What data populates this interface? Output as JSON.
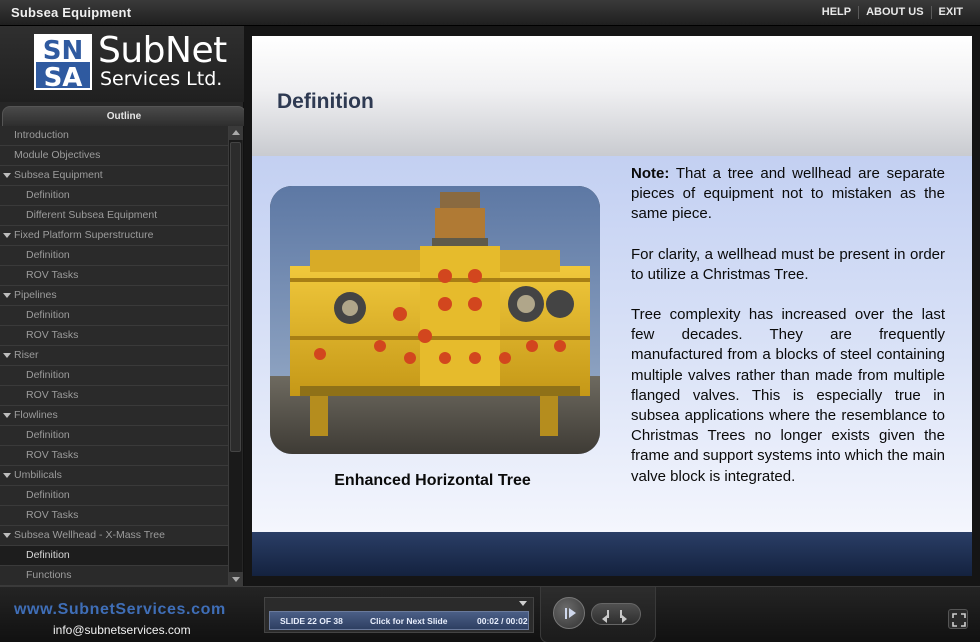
{
  "app": {
    "title": "Subsea Equipment",
    "nav": [
      "HELP",
      "ABOUT US",
      "EXIT"
    ]
  },
  "logo": {
    "mark_top": "SN",
    "mark_bottom": "SA",
    "name": "SubNet",
    "subtitle": "Services Ltd."
  },
  "outline": {
    "tab_label": "Outline",
    "items": [
      {
        "label": "Introduction",
        "level": 0,
        "expanded": false,
        "active": false
      },
      {
        "label": "Module Objectives",
        "level": 0,
        "expanded": false,
        "active": false
      },
      {
        "label": "Subsea Equipment",
        "level": 0,
        "expanded": true,
        "active": false
      },
      {
        "label": "Definition",
        "level": 1,
        "active": false
      },
      {
        "label": "Different Subsea Equipment",
        "level": 1,
        "active": false
      },
      {
        "label": "Fixed Platform Superstructure",
        "level": 0,
        "expanded": true,
        "active": false
      },
      {
        "label": "Definition",
        "level": 1,
        "active": false
      },
      {
        "label": "ROV Tasks",
        "level": 1,
        "active": false
      },
      {
        "label": "Pipelines",
        "level": 0,
        "expanded": true,
        "active": false
      },
      {
        "label": "Definition",
        "level": 1,
        "active": false
      },
      {
        "label": "ROV Tasks",
        "level": 1,
        "active": false
      },
      {
        "label": "Riser",
        "level": 0,
        "expanded": true,
        "active": false
      },
      {
        "label": "Definition",
        "level": 1,
        "active": false
      },
      {
        "label": "ROV Tasks",
        "level": 1,
        "active": false
      },
      {
        "label": "Flowlines",
        "level": 0,
        "expanded": true,
        "active": false
      },
      {
        "label": "Definition",
        "level": 1,
        "active": false
      },
      {
        "label": "ROV Tasks",
        "level": 1,
        "active": false
      },
      {
        "label": "Umbilicals",
        "level": 0,
        "expanded": true,
        "active": false
      },
      {
        "label": "Definition",
        "level": 1,
        "active": false
      },
      {
        "label": "ROV Tasks",
        "level": 1,
        "active": false
      },
      {
        "label": "Subsea Wellhead - X-Mass Tree",
        "level": 0,
        "expanded": true,
        "active": false
      },
      {
        "label": "Definition",
        "level": 1,
        "active": true
      },
      {
        "label": "Functions",
        "level": 1,
        "active": false
      }
    ]
  },
  "slide": {
    "title": "Definition",
    "image_caption": "Enhanced Horizontal Tree",
    "note_label": "Note:",
    "note_text": " That a tree and wellhead are separate pieces of equipment not to mistaken as the same piece.",
    "paragraph2": "For clarity, a wellhead must be present in order to utilize a Christmas Tree.",
    "paragraph3": "Tree complexity has increased over the last few decades. They are frequently manufactured from a blocks of steel containing multiple valves rather than made from multiple flanged valves. This is especially true in subsea applications where the resemblance to Christmas Trees no longer exists given the frame and support systems into which the main valve block is integrated."
  },
  "footer": {
    "website": "www.SubnetServices.com",
    "email": "info@subnetservices.com",
    "slide_count": "SLIDE 22 OF 38",
    "next_hint": "Click for Next Slide",
    "time": "00:02 / 00:02"
  },
  "colors": {
    "accent_blue": "#3f6eb7",
    "title_navy": "#2e3a52",
    "machine_yellow": "#e3b726"
  }
}
